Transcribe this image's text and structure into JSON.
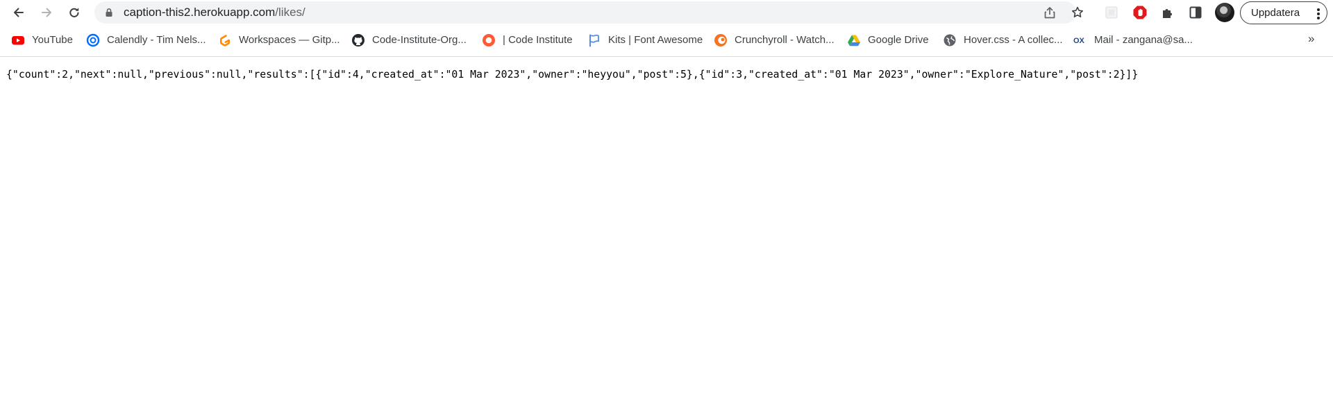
{
  "browser": {
    "url_host": "caption-this2.herokuapp.com",
    "url_path": "/likes/",
    "update_label": "Uppdatera",
    "colors": {
      "accent": "#1a73e8",
      "toolbar": "#ffffff",
      "omnibox": "#f1f3f4",
      "text": "#202124"
    }
  },
  "bookmarks": [
    {
      "label": "YouTube",
      "icon": "youtube-icon"
    },
    {
      "label": "Calendly - Tim Nels...",
      "icon": "calendly-icon"
    },
    {
      "label": "Workspaces — Gitp...",
      "icon": "gitpod-icon"
    },
    {
      "label": "Code-Institute-Org...",
      "icon": "github-icon"
    },
    {
      "label": "| Code Institute",
      "icon": "code-institute-icon"
    },
    {
      "label": "Kits | Font Awesome",
      "icon": "flag-icon"
    },
    {
      "label": "Crunchyroll - Watch...",
      "icon": "crunchyroll-icon"
    },
    {
      "label": "Google Drive",
      "icon": "google-drive-icon"
    },
    {
      "label": "Hover.css - A collec...",
      "icon": "globe-icon"
    },
    {
      "label": "Mail - zangana@sa...",
      "icon": "ox-mail-icon"
    }
  ],
  "bookmarks_overflow": "»",
  "page": {
    "raw_json": "{\"count\":2,\"next\":null,\"previous\":null,\"results\":[{\"id\":4,\"created_at\":\"01 Mar 2023\",\"owner\":\"heyyou\",\"post\":5},{\"id\":3,\"created_at\":\"01 Mar 2023\",\"owner\":\"Explore_Nature\",\"post\":2}]}"
  }
}
